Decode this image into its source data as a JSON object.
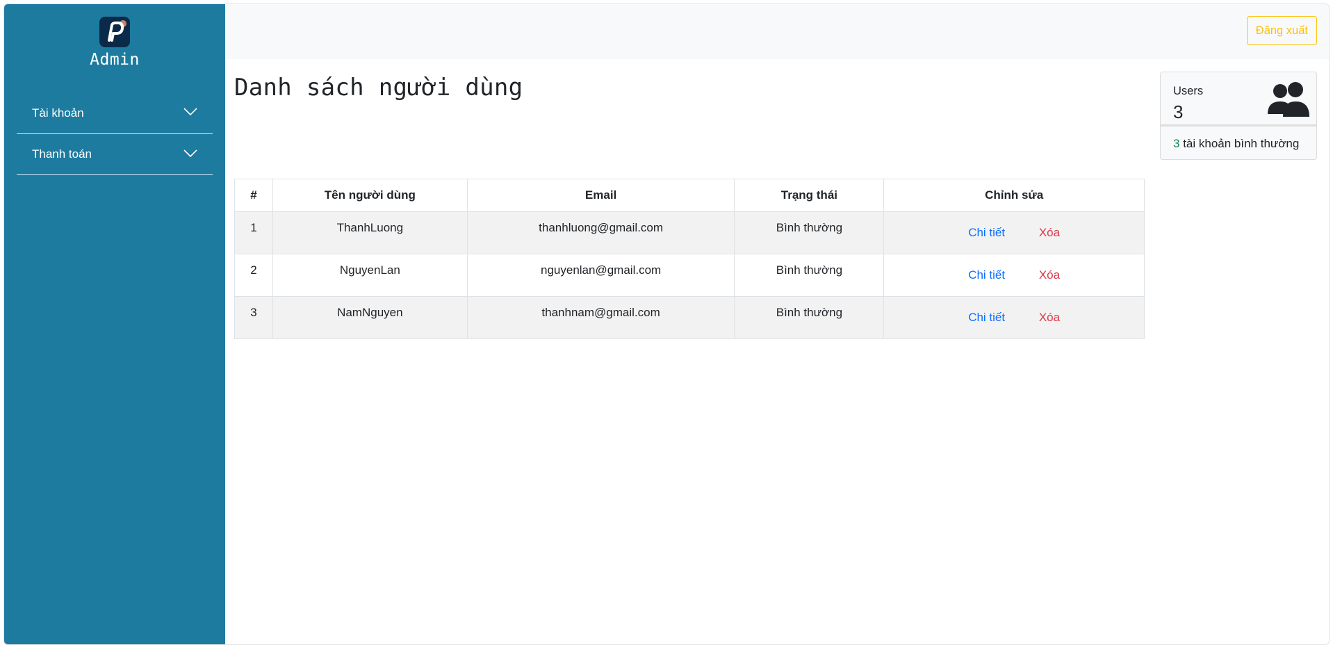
{
  "sidebar": {
    "brand": "Admin",
    "items": [
      {
        "label": "Tài khoản"
      },
      {
        "label": "Thanh toán"
      }
    ]
  },
  "topbar": {
    "logout_label": "Đăng xuất"
  },
  "main": {
    "title": "Danh sách người dùng",
    "table": {
      "headers": [
        "#",
        "Tên người dùng",
        "Email",
        "Trạng thái",
        "Chỉnh sửa"
      ],
      "rows": [
        {
          "index": "1",
          "username": "ThanhLuong",
          "email": "thanhluong@gmail.com",
          "status": "Bình thường",
          "detail": "Chi tiết",
          "delete": "Xóa"
        },
        {
          "index": "2",
          "username": "NguyenLan",
          "email": "nguyenlan@gmail.com",
          "status": "Bình thường",
          "detail": "Chi tiết",
          "delete": "Xóa"
        },
        {
          "index": "3",
          "username": "NamNguyen",
          "email": "thanhnam@gmail.com",
          "status": "Bình thường",
          "detail": "Chi tiết",
          "delete": "Xóa"
        }
      ]
    }
  },
  "users_card": {
    "label": "Users",
    "count": "3",
    "footer_count": "3",
    "footer_text": " tài khoản bình thường",
    "icon": "users-icon"
  },
  "colors": {
    "sidebar": "#1e7ba0",
    "logout": "#ffc107",
    "detail_link": "#0d6efd",
    "delete_link": "#dc3545",
    "count_green": "#198754"
  }
}
